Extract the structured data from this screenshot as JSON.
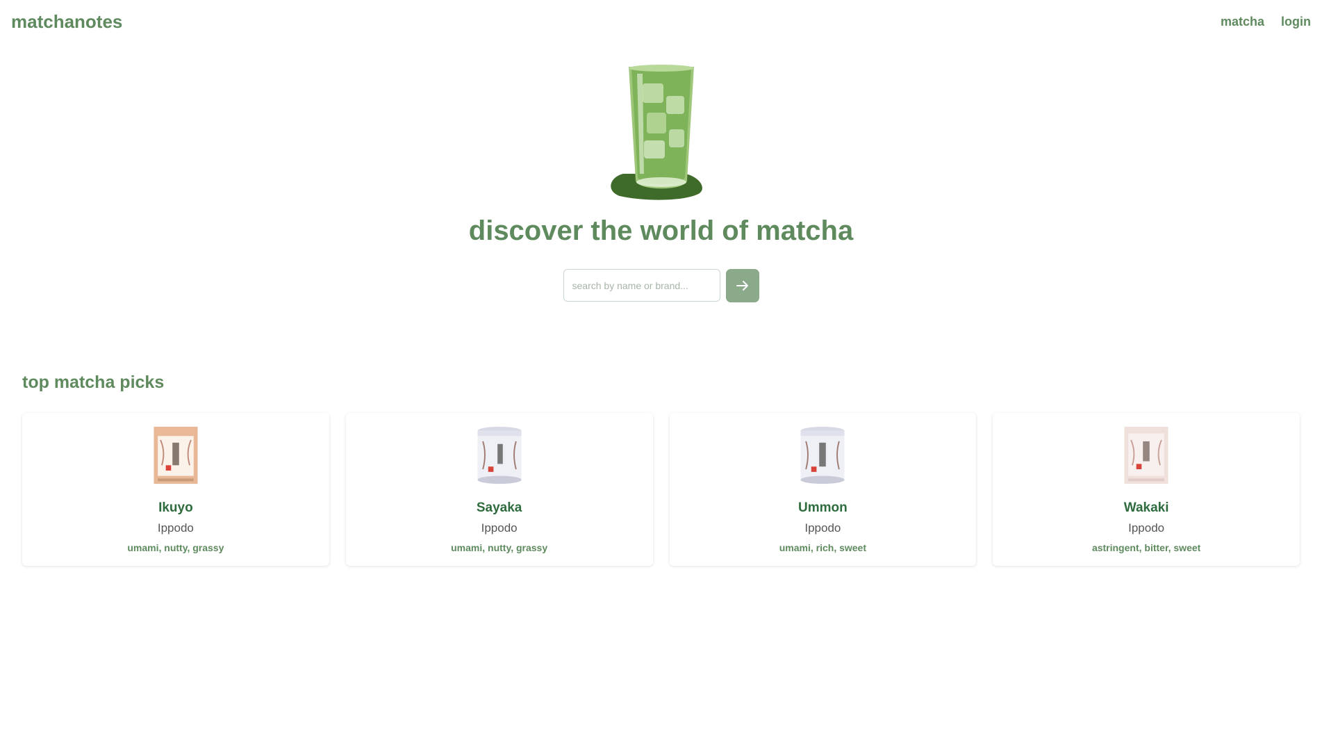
{
  "header": {
    "brand": "matchanotes",
    "nav": [
      "matcha",
      "login"
    ]
  },
  "hero": {
    "image": "iced-matcha-glass",
    "title": "discover the world of matcha"
  },
  "search": {
    "placeholder": "search by name or brand...",
    "value": "",
    "button_icon": "arrow-right-icon"
  },
  "picks": {
    "title": "top matcha picks",
    "items": [
      {
        "name": "Ikuyo",
        "brand": "Ippodo",
        "notes": "umami, nutty, grassy",
        "package": "box",
        "package_color": "#e9b896"
      },
      {
        "name": "Sayaka",
        "brand": "Ippodo",
        "notes": "umami, nutty, grassy",
        "package": "tin",
        "package_color": "#eef0f6"
      },
      {
        "name": "Ummon",
        "brand": "Ippodo",
        "notes": "umami, rich, sweet",
        "package": "tin",
        "package_color": "#eef0f6"
      },
      {
        "name": "Wakaki",
        "brand": "Ippodo",
        "notes": "astringent, bitter, sweet",
        "package": "box",
        "package_color": "#efe0dc"
      }
    ]
  },
  "colors": {
    "brand_green": "#5e8a5e",
    "name_green": "#2e6b3e",
    "button_green": "#8aaa8a",
    "matcha_green": "#7fb35a",
    "shadow_green": "#3f6b2a"
  }
}
